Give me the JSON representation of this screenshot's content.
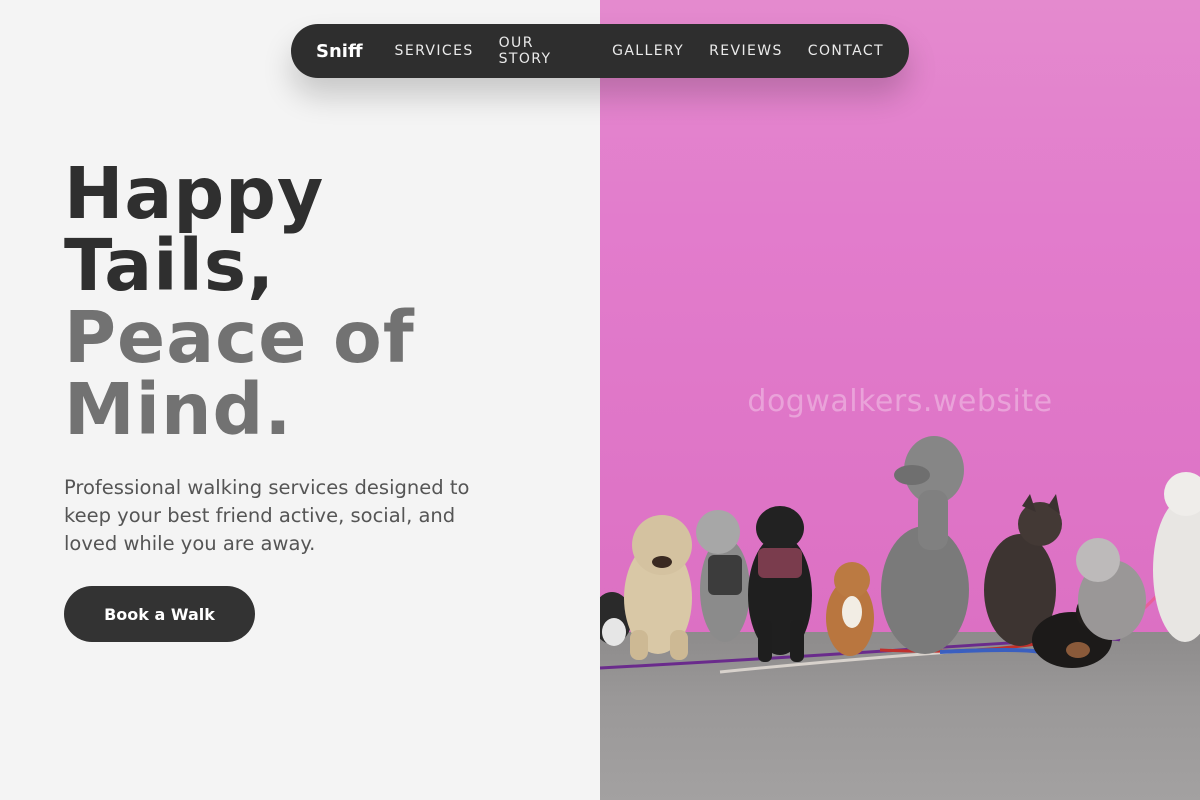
{
  "nav": {
    "brand": "Sniff",
    "links": [
      "SERVICES",
      "OUR STORY",
      "GALLERY",
      "REVIEWS",
      "CONTACT"
    ]
  },
  "hero": {
    "line1": "Happy",
    "line2": "Tails,",
    "line3": "Peace of",
    "line4": "Mind.",
    "subtext": "Professional walking services designed to keep your best friend active, social, and loved while you are away.",
    "cta_label": "Book a Walk"
  },
  "image": {
    "watermark": "dogwalkers.website",
    "description_icon": "dogs-on-leashes-photo"
  },
  "colors": {
    "nav_bg": "#2e2e2e",
    "heading_dark": "#2f2f2f",
    "heading_gray": "#727272",
    "button_bg": "#333333",
    "wall_pink": "#e07dc4"
  }
}
